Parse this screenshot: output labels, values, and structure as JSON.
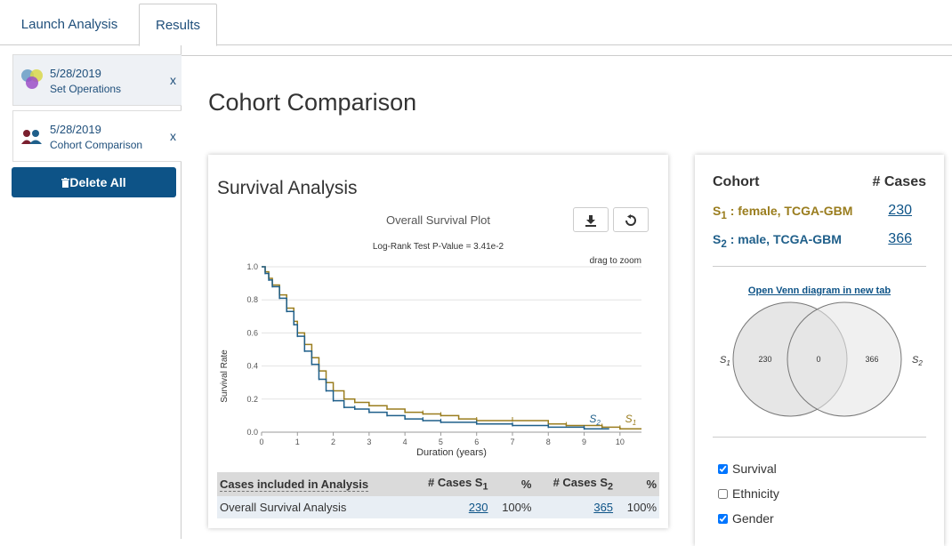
{
  "tabs": {
    "launch": "Launch Analysis",
    "results": "Results"
  },
  "sidebar": {
    "items": [
      {
        "date": "5/28/2019",
        "name": "Set Operations",
        "close": "x"
      },
      {
        "date": "5/28/2019",
        "name": "Cohort Comparison",
        "close": "x"
      }
    ],
    "delete_all": "Delete All"
  },
  "page_title": "Cohort Comparison",
  "survival": {
    "title": "Survival Analysis",
    "plot_title": "Overall Survival Plot",
    "logrank": "Log-Rank Test P-Value = 3.41e-2",
    "drag_hint": "drag to zoom",
    "table": {
      "headers": [
        "Cases included in Analysis",
        "# Cases S",
        "%",
        "# Cases S",
        "%"
      ],
      "header_subs": [
        "1",
        "2"
      ],
      "rows": [
        {
          "label": "Overall Survival Analysis",
          "s1_cases": "230",
          "s1_pct": "100%",
          "s2_cases": "365",
          "s2_pct": "100%"
        }
      ]
    }
  },
  "chart_data": {
    "type": "line",
    "title": "",
    "xlabel": "Duration (years)",
    "ylabel": "Survival Rate",
    "xlim": [
      0,
      10.6
    ],
    "ylim": [
      0,
      1.0
    ],
    "xticks": [
      "0",
      "1",
      "2",
      "3",
      "4",
      "5",
      "6",
      "7",
      "8",
      "9",
      "10"
    ],
    "yticks": [
      "0.0",
      "0.2",
      "0.4",
      "0.6",
      "0.8",
      "1.0"
    ],
    "grid": true,
    "series": [
      {
        "name": "S1",
        "color": "#9a7d1e",
        "x": [
          0,
          0.1,
          0.2,
          0.3,
          0.5,
          0.7,
          0.9,
          1.0,
          1.2,
          1.4,
          1.6,
          1.8,
          2.0,
          2.3,
          2.6,
          3.0,
          3.5,
          4.0,
          4.5,
          5.0,
          5.5,
          6.0,
          7.0,
          8.0,
          8.5,
          9.5,
          10.0,
          10.6
        ],
        "y": [
          1.0,
          0.97,
          0.93,
          0.89,
          0.83,
          0.75,
          0.67,
          0.6,
          0.53,
          0.45,
          0.37,
          0.3,
          0.25,
          0.2,
          0.18,
          0.16,
          0.14,
          0.12,
          0.11,
          0.1,
          0.08,
          0.07,
          0.07,
          0.05,
          0.04,
          0.03,
          0.02,
          0.02
        ]
      },
      {
        "name": "S2",
        "color": "#1f5f8a",
        "x": [
          0,
          0.1,
          0.2,
          0.3,
          0.5,
          0.7,
          0.9,
          1.0,
          1.2,
          1.4,
          1.6,
          1.8,
          2.0,
          2.3,
          2.6,
          3.0,
          3.5,
          4.0,
          4.5,
          5.0,
          6.0,
          7.0,
          8.0,
          9.0,
          9.7
        ],
        "y": [
          1.0,
          0.96,
          0.92,
          0.88,
          0.81,
          0.73,
          0.65,
          0.58,
          0.49,
          0.41,
          0.32,
          0.25,
          0.19,
          0.15,
          0.14,
          0.12,
          0.1,
          0.08,
          0.07,
          0.06,
          0.05,
          0.04,
          0.03,
          0.02,
          0.02
        ]
      }
    ],
    "labels": {
      "s1": "S",
      "s2": "S",
      "sub1": "1",
      "sub2": "2"
    }
  },
  "cohort": {
    "head_cohort": "Cohort",
    "head_cases": "# Cases",
    "rows": [
      {
        "label": "S",
        "sub": "1",
        "desc": " : female, TCGA-GBM",
        "cases": "230",
        "color": "#9a7d1e"
      },
      {
        "label": "S",
        "sub": "2",
        "desc": " : male, TCGA-GBM",
        "cases": "366",
        "color": "#1f5f8a"
      }
    ],
    "venn_link": "Open Venn diagram in new tab",
    "venn": {
      "left": "230",
      "middle": "0",
      "right": "366",
      "s": "S",
      "sub1": "1",
      "sub2": "2"
    },
    "checks": [
      {
        "label": "Survival",
        "checked": true
      },
      {
        "label": "Ethnicity",
        "checked": false
      },
      {
        "label": "Gender",
        "checked": true
      }
    ]
  }
}
